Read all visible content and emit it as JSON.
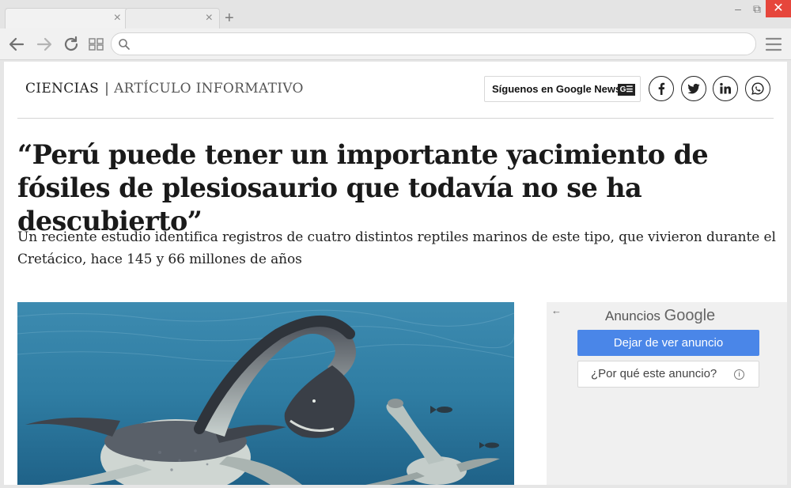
{
  "browser": {
    "tabs": [
      {
        "title": "",
        "close_glyph": "×"
      },
      {
        "title": "",
        "close_glyph": "×"
      }
    ],
    "new_tab_glyph": "+",
    "window_controls": {
      "minimize": "–",
      "maximize": "⧉",
      "close": "✕"
    },
    "address_bar": {
      "value": "",
      "placeholder": ""
    },
    "icons": [
      "back-arrow-icon",
      "forward-arrow-icon",
      "reload-icon",
      "apps-grid-icon",
      "search-icon",
      "menu-icon"
    ]
  },
  "article": {
    "section": "CIENCIAS",
    "separator": "|",
    "subsection": "ARTÍCULO INFORMATIVO",
    "follow_label": "Síguenos en Google News",
    "follow_icon_text": "G☰",
    "social": [
      "facebook-icon",
      "twitter-icon",
      "linkedin-icon",
      "whatsapp-icon"
    ],
    "headline": "“Perú puede tener un importante yacimiento de fósiles de plesiosaurio que todavía no se ha descubierto”",
    "dek": "Un reciente estudio identifica registros de cuatro distintos reptiles marinos de este tipo, que vivieron durante el Cretácico, hace 145 y 66 millones de años"
  },
  "ad": {
    "back_glyph": "←",
    "title_prefix": "Anuncios",
    "title_brand": "Google",
    "stop_label": "Dejar de ver anuncio",
    "why_label": "¿Por qué este anuncio?",
    "info_glyph": "i"
  },
  "colors": {
    "ad_button_blue": "#4a86e8",
    "window_close_red": "#e6463c",
    "ocean": "#2f7da3"
  }
}
